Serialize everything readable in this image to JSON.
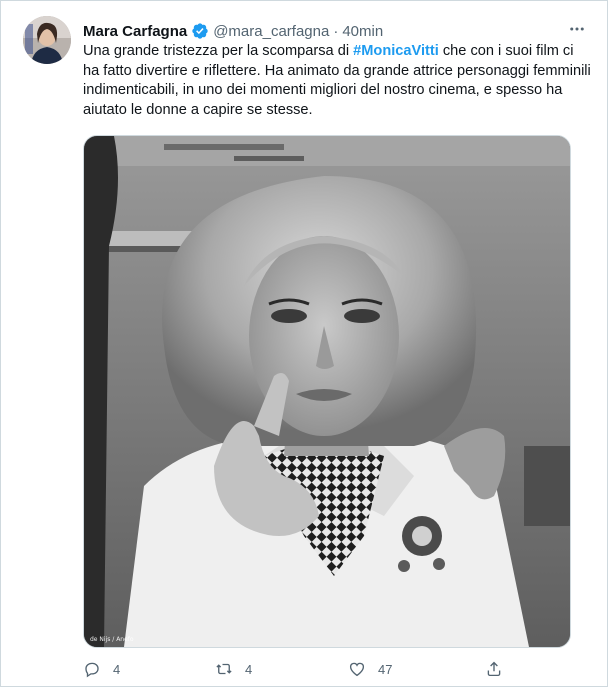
{
  "tweet": {
    "author_name": "Mara Carfagna",
    "handle": "@mara_carfagna",
    "separator": "·",
    "time": "40min",
    "text_before": "Una grande tristezza per la scomparsa di ",
    "hashtag": "#MonicaVitti",
    "text_after": " che con i suoi film ci ha fatto divertire e riflettere. Ha animato da grande attrice personaggi femminili indimenticabili, in uno dei momenti migliori del nostro cinema, e spesso ha aiutato le donne a capire se stesse.",
    "photo_credit": "de Nijs / Anefo"
  },
  "actions": {
    "replies": "4",
    "retweets": "4",
    "likes": "47"
  },
  "colors": {
    "accent": "#1d9bf0",
    "text": "#0f1419",
    "muted": "#536471",
    "border": "#cfd9de"
  },
  "icons": [
    "verified-badge-icon",
    "more-options-icon",
    "reply-icon",
    "retweet-icon",
    "like-icon",
    "share-icon"
  ]
}
